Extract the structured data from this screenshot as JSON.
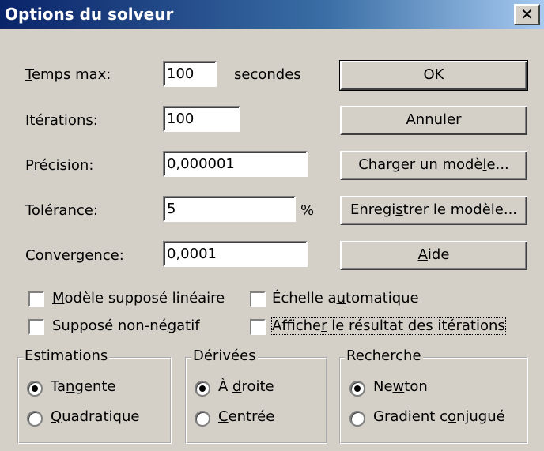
{
  "window": {
    "title": "Options du solveur",
    "close_glyph": "✕"
  },
  "fields": {
    "temps_max": {
      "label_first": "T",
      "label_rest": "emps max:",
      "value": "100",
      "unit": "secondes"
    },
    "iterations": {
      "label_first": "I",
      "label_rest": "térations:",
      "value": "100"
    },
    "precision": {
      "label_first": "P",
      "label_rest": "récision:",
      "value": "0,000001"
    },
    "tolerance": {
      "label_pre": "Toléranc",
      "label_u": "e",
      "label_post": ":",
      "value": "5",
      "unit": "%"
    },
    "convergence": {
      "label_pre": "Con",
      "label_u": "v",
      "label_post": "ergence:",
      "value": "0,0001"
    }
  },
  "buttons": {
    "ok": "OK",
    "annuler": "Annuler",
    "charger_pre": "Charger un modè",
    "charger_u": "l",
    "charger_post": "e...",
    "enregistrer_pre": "Enregi",
    "enregistrer_u": "s",
    "enregistrer_post": "trer le modèle...",
    "aide_u": "A",
    "aide_post": "ide"
  },
  "checkboxes": {
    "lineaire": {
      "u": "M",
      "rest": "odèle supposé linéaire",
      "checked": false
    },
    "echelle": {
      "pre": "Échelle a",
      "u": "u",
      "post": "tomatique",
      "checked": false
    },
    "non_negatif": {
      "pre": "Supposé non-né",
      "u": "g",
      "post": "atif",
      "checked": false
    },
    "afficher": {
      "pre": "Affiche",
      "u": "r",
      "post": " le résultat des itérations",
      "checked": false
    }
  },
  "groups": {
    "estimations": {
      "title": "Estimations",
      "tangente": {
        "pre": "Ta",
        "u": "n",
        "post": "gente",
        "selected": true
      },
      "quadratique": {
        "u": "Q",
        "post": "uadratique",
        "selected": false
      }
    },
    "derivees": {
      "title": "Dérivées",
      "droite": {
        "pre": "À ",
        "u": "d",
        "post": "roite",
        "selected": true
      },
      "centree": {
        "u": "C",
        "post": "entrée",
        "selected": false
      }
    },
    "recherche": {
      "title": "Recherche",
      "newton": {
        "pre": "Ne",
        "u": "w",
        "post": "ton",
        "selected": true
      },
      "gradient": {
        "pre": "Gradient c",
        "u": "o",
        "post": "njugué",
        "selected": false
      }
    }
  }
}
